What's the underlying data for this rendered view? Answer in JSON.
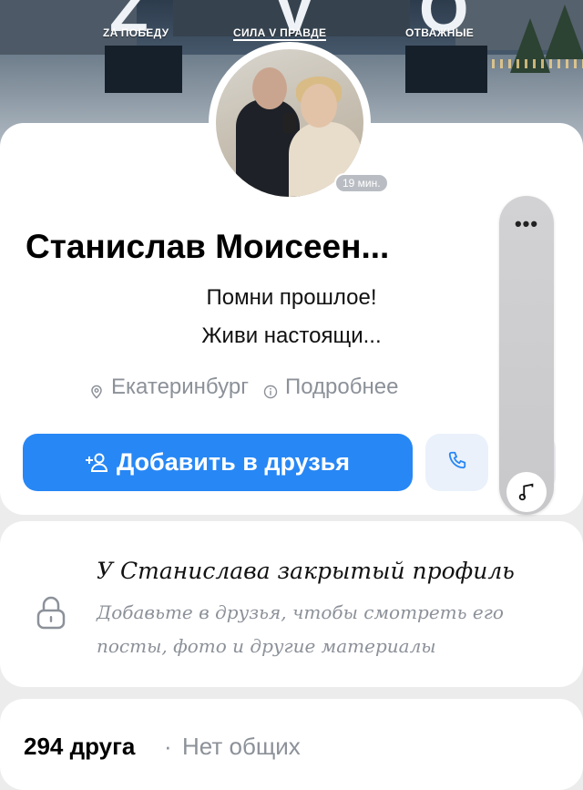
{
  "cover": {
    "taglines": [
      "ZA ПОБЕДУ",
      "СИЛА V ПРАВДЕ",
      "ОТВАЖНЫЕ"
    ]
  },
  "profile": {
    "online_badge": "19 мин.",
    "name": "Станислав Моисеен...",
    "status_line_1": "Помни прошлое!",
    "status_line_2": "Живи настоящи...",
    "city": "Екатеринбург",
    "details_link": "Подробнее"
  },
  "actions": {
    "add_friend_label": "Добавить в друзья"
  },
  "overlay": {
    "more_label": "•••"
  },
  "private_profile": {
    "title": "У Станислава закрытый профиль",
    "description": "Добавьте в друзья, чтобы смотреть его посты, фото и другие материалы"
  },
  "friends": {
    "count_label": "294 друга",
    "separator": "·",
    "common_label": "Нет общих"
  },
  "colors": {
    "accent": "#2787f5",
    "muted_text": "#8c9199",
    "background": "#ececec"
  },
  "icons": {
    "location": "location-pin-icon",
    "info": "info-circle-icon",
    "add_friend": "add-user-icon",
    "call": "phone-icon",
    "lock": "lock-icon",
    "music": "music-note-icon",
    "more": "more-dots-icon"
  }
}
